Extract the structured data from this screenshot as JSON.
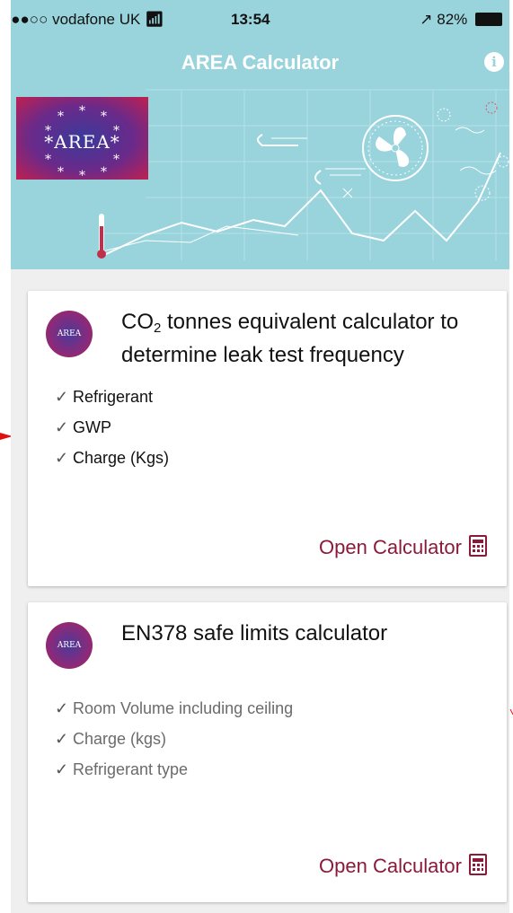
{
  "status_bar": {
    "carrier": "●●●○○ vodafone UK",
    "wifi_icon": "wifi-icon",
    "time": "13:54",
    "location_icon": "location-arrow-icon",
    "battery": "82%"
  },
  "nav": {
    "title": "AREA Calculator",
    "info_icon": "info-icon",
    "info_glyph": "i"
  },
  "logo": {
    "text": "*AREA*"
  },
  "cards": [
    {
      "avatar_text": "AREA",
      "title_prefix": "CO",
      "title_sub": "2",
      "title_suffix": " tonnes equivalent calculator to determine leak test frequency",
      "items": [
        "Refrigerant",
        "GWP",
        "Charge (Kgs)"
      ],
      "button_label": "Open Calculator"
    },
    {
      "avatar_text": "AREA",
      "title": "EN378 safe limits calculator",
      "items": [
        "Room Volume including ceiling",
        "Charge (kgs)",
        "Refrigerant type"
      ],
      "button_label": "Open Calculator"
    }
  ],
  "colors": {
    "header_bg": "#99d3dc",
    "accent": "#8b1a3a",
    "page_bg": "#efefef",
    "annotation": "#e01010"
  }
}
